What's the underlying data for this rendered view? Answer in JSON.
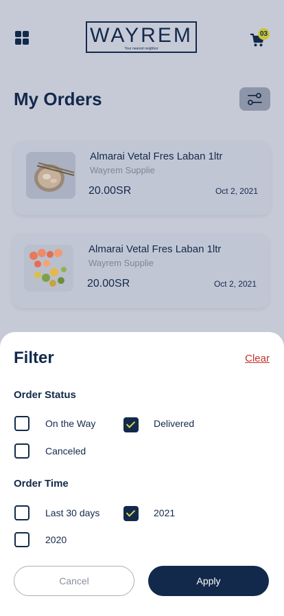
{
  "header": {
    "logo_word": "WAYREM",
    "logo_tagline": "Your nearest neighbor",
    "cart_count": "03"
  },
  "page": {
    "title": "My Orders"
  },
  "orders": [
    {
      "name": "Almarai Vetal Fres Laban 1ltr",
      "supplier": "Wayrem Supplie",
      "price": "20.00SR",
      "date": "Oct 2, 2021"
    },
    {
      "name": "Almarai Vetal Fres Laban 1ltr",
      "supplier": "Wayrem Supplie",
      "price": "20.00SR",
      "date": "Oct 2, 2021"
    }
  ],
  "filter": {
    "title": "Filter",
    "clear_label": "Clear",
    "status_title": "Order Status",
    "status_options": [
      {
        "label": "On the Way",
        "checked": false
      },
      {
        "label": "Delivered",
        "checked": true
      },
      {
        "label": "Canceled",
        "checked": false
      }
    ],
    "time_title": "Order Time",
    "time_options": [
      {
        "label": "Last 30 days",
        "checked": false
      },
      {
        "label": "2021",
        "checked": true
      },
      {
        "label": "2020",
        "checked": false
      }
    ],
    "cancel_label": "Cancel",
    "apply_label": "Apply"
  },
  "colors": {
    "navy": "#13294b",
    "accent": "#d8d64a",
    "clear": "#c0322d"
  },
  "icons": [
    "grid-menu-icon",
    "cart-icon",
    "filter-sliders-icon",
    "checkbox-check-icon"
  ]
}
